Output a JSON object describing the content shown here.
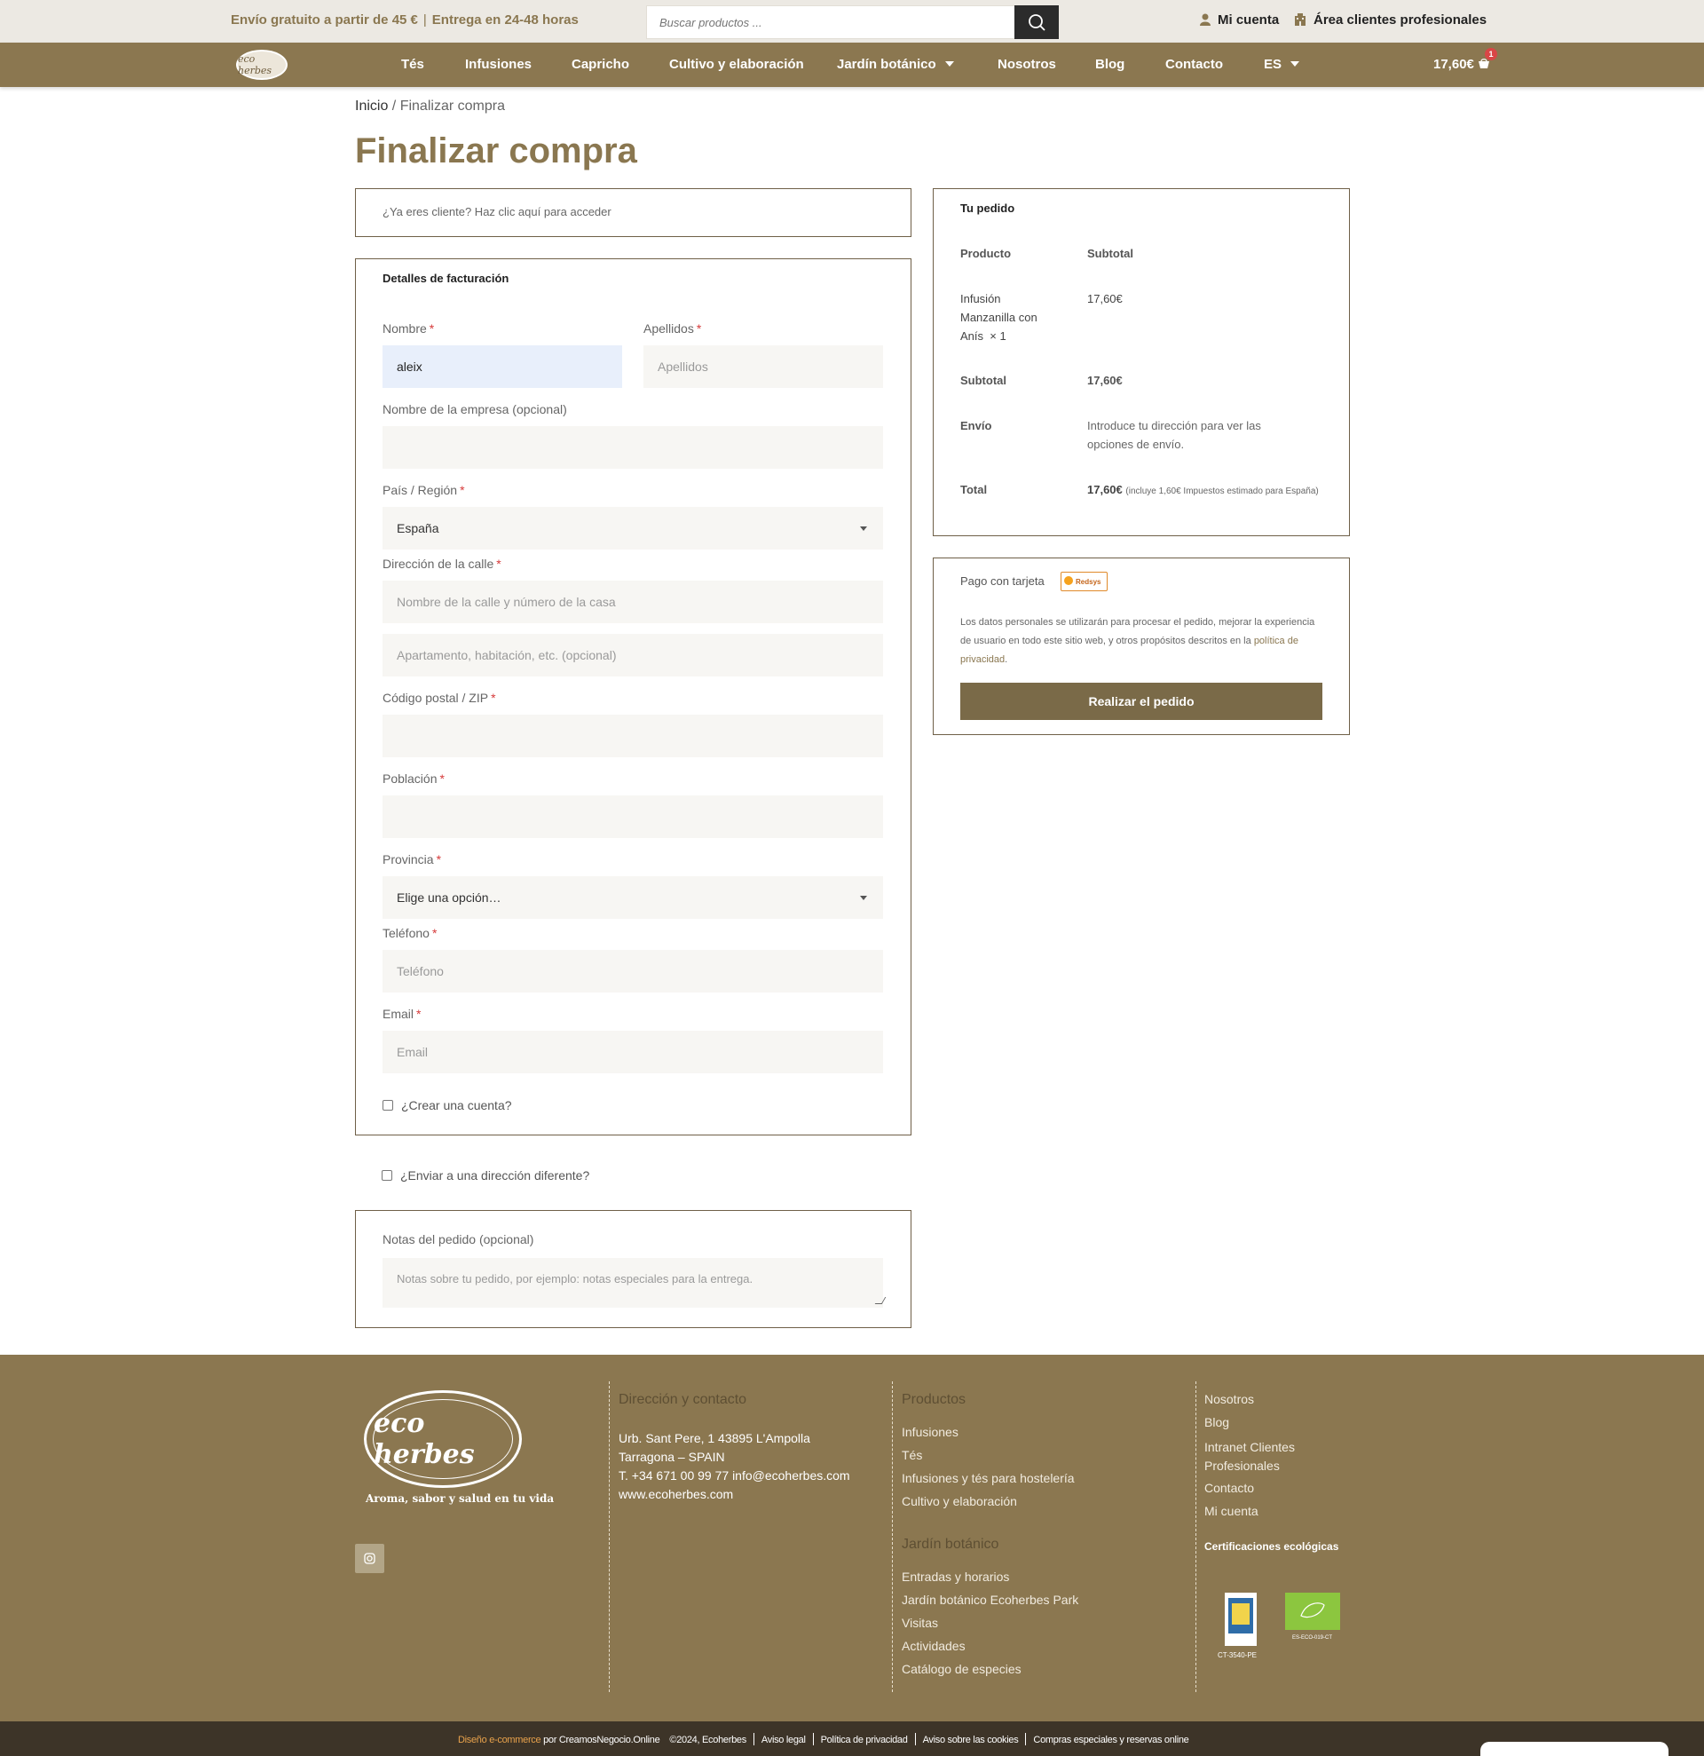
{
  "topbar": {
    "promo_shipping": "Envío gratuito a partir de 45 €",
    "promo_delivery": "Entrega en 24-48 horas",
    "search_placeholder": "Buscar productos ...",
    "my_account": "Mi cuenta",
    "pro_area": "Área clientes profesionales"
  },
  "nav": {
    "items": [
      "Tés",
      "Infusiones",
      "Capricho",
      "Cultivo y elaboración",
      "Jardín botánico",
      "Nosotros",
      "Blog",
      "Contacto",
      "ES"
    ],
    "cart_total": "17,60€",
    "cart_count": "1"
  },
  "breadcrumb": {
    "home": "Inicio",
    "sep": " / ",
    "current": "Finalizar compra"
  },
  "page_title": "Finalizar compra",
  "login": {
    "text": "¿Ya eres cliente? Haz clic aquí para acceder"
  },
  "billing": {
    "heading": "Detalles de facturación",
    "nombre_label": "Nombre",
    "nombre_value": "aleix",
    "apellidos_label": "Apellidos",
    "apellidos_placeholder": "Apellidos",
    "empresa_label": "Nombre de la empresa (opcional)",
    "pais_label": "País / Región",
    "pais_value": "España",
    "calle_label": "Dirección de la calle",
    "calle_placeholder": "Nombre de la calle y número de la casa",
    "calle2_placeholder": "Apartamento, habitación, etc. (opcional)",
    "cp_label": "Código postal / ZIP",
    "poblacion_label": "Población",
    "provincia_label": "Provincia",
    "provincia_value": "Elige una opción…",
    "telefono_label": "Teléfono",
    "telefono_placeholder": "Teléfono",
    "email_label": "Email",
    "email_placeholder": "Email",
    "create_account": "¿Crear una cuenta?",
    "required_mark": "*"
  },
  "ship_different": "¿Enviar a una dirección diferente?",
  "notes": {
    "label": "Notas del pedido (opcional)",
    "placeholder": "Notas sobre tu pedido, por ejemplo: notas especiales para la entrega."
  },
  "order": {
    "heading": "Tu pedido",
    "col_product": "Producto",
    "col_subtotal": "Subtotal",
    "product_name": "Infusión Manzanilla con Anís",
    "product_qty": "× 1",
    "product_price": "17,60€",
    "subtotal_label": "Subtotal",
    "subtotal_value": "17,60€",
    "shipping_label": "Envío",
    "shipping_value": "Introduce tu dirección para ver las opciones de envío.",
    "total_label": "Total",
    "total_value": "17,60€",
    "total_note": "(incluye 1,60€ Impuestos estimado para España)"
  },
  "payment": {
    "title": "Pago con tarjeta",
    "badge": "Redsys",
    "privacy": "Los datos personales se utilizarán para procesar el pedido, mejorar la experiencia de usuario en todo este sitio web, y otros propósitos descritos en la",
    "privacy_link": "política de privacidad",
    "place_order": "Realizar el pedido"
  },
  "footer": {
    "tagline": "Aroma, sabor y salud en tu vida",
    "contact_heading": "Dirección y contacto",
    "address1": "Urb. Sant Pere, 1 43895 L'Ampolla",
    "address2": "Tarragona – SPAIN",
    "phone": "T. +34 671 00 99 77",
    "email": "info@ecoherbes.com",
    "web": "www.ecoherbes.com",
    "products_heading": "Productos",
    "products": [
      "Infusiones",
      "Tés",
      "Infusiones y tés para hostelería",
      "Cultivo y elaboración"
    ],
    "garden_heading": "Jardín botánico",
    "garden": [
      "Entradas y horarios",
      "Jardín botánico Ecoherbes Park",
      "Visitas",
      "Actividades",
      "Catálogo de especies"
    ],
    "links": [
      "Nosotros",
      "Blog",
      "Intranet Clientes Profesionales",
      "Contacto",
      "Mi cuenta"
    ],
    "cert_heading": "Certificaciones ecológicas",
    "cert1_code": "CT-3540-PE",
    "cert2_code": "ES-ECO-019-CT"
  },
  "bottombar": {
    "design_prefix": "Diseño e-commerce",
    "design_by": "por CreamosNegocio.Online",
    "copyright": "©2024, Ecoherbes",
    "links": [
      "Aviso legal",
      "Política de privacidad",
      "Aviso sobre las cookies",
      "Compras especiales y reservas online"
    ]
  },
  "colors": {
    "brand": "#8b7750",
    "accent_required": "#d63a3a",
    "dark": "#3d3428"
  }
}
